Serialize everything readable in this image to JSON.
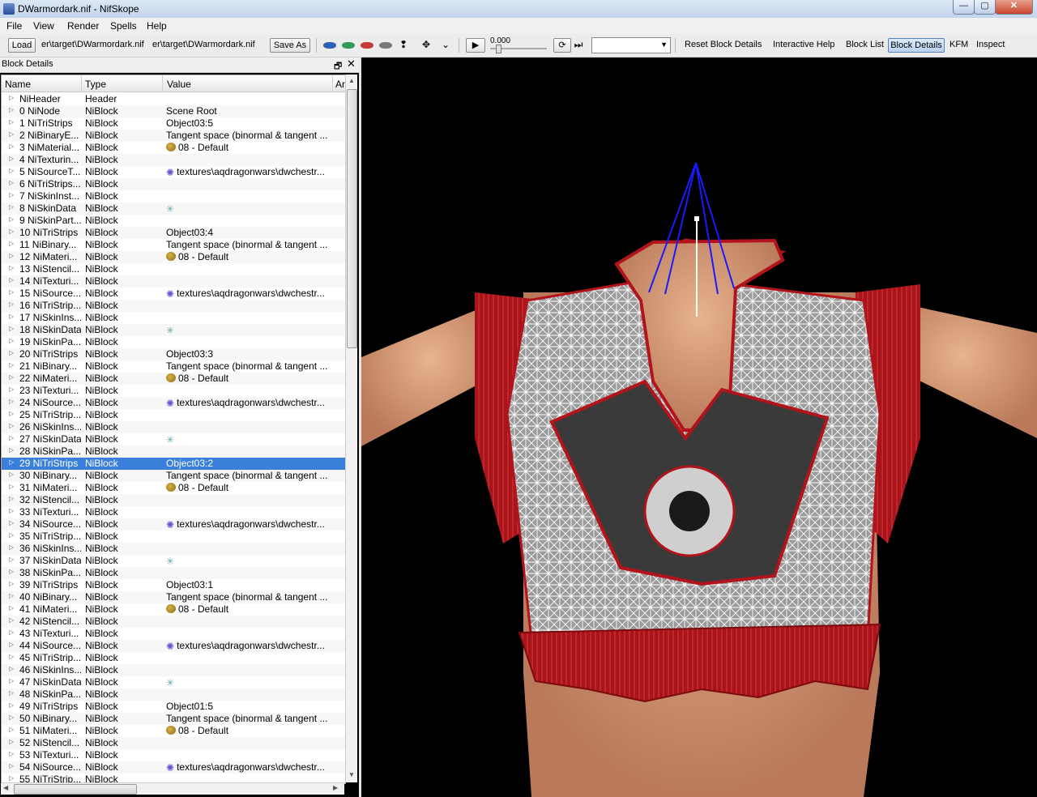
{
  "window": {
    "title": "DWarmordark.nif - NifSkope",
    "minimize": "—",
    "maximize": "▢",
    "close": "✕"
  },
  "menu": [
    "File",
    "View",
    "Render",
    "Spells",
    "Help"
  ],
  "toolbar": {
    "load_label": "Load",
    "load_path": "er\\target\\DWarmordark.nif",
    "save_path": "er\\target\\DWarmordark.nif",
    "save_as_label": "Save As",
    "time_value": "0.000",
    "reset_block_details": "Reset Block Details",
    "interactive_help": "Interactive Help",
    "block_list": "Block List",
    "block_details": "Block Details",
    "kfm": "KFM",
    "inspect": "Inspect"
  },
  "dock": {
    "title": "Block Details",
    "float": "🗗",
    "close": "✕"
  },
  "columns": {
    "name": "Name",
    "type": "Type",
    "value": "Value",
    "extra": "Ar"
  },
  "rows": [
    {
      "name": "NiHeader",
      "type": "Header",
      "value": "",
      "icon": ""
    },
    {
      "name": "0 NiNode",
      "type": "NiBlock",
      "value": "Scene Root",
      "icon": ""
    },
    {
      "name": "1 NiTriStrips",
      "type": "NiBlock",
      "value": "Object03:5",
      "icon": ""
    },
    {
      "name": "2 NiBinaryE...",
      "type": "NiBlock",
      "value": "Tangent space (binormal & tangent ...",
      "icon": ""
    },
    {
      "name": "3 NiMaterial...",
      "type": "NiBlock",
      "value": "08 - Default",
      "icon": "palette"
    },
    {
      "name": "4 NiTexturin...",
      "type": "NiBlock",
      "value": "",
      "icon": ""
    },
    {
      "name": "5 NiSourceT...",
      "type": "NiBlock",
      "value": "textures\\aqdragonwars\\dwchestr...",
      "icon": "texture"
    },
    {
      "name": "6 NiTriStrips...",
      "type": "NiBlock",
      "value": "",
      "icon": ""
    },
    {
      "name": "7 NiSkinInst...",
      "type": "NiBlock",
      "value": "",
      "icon": ""
    },
    {
      "name": "8 NiSkinData",
      "type": "NiBlock",
      "value": "",
      "icon": "skin"
    },
    {
      "name": "9 NiSkinPart...",
      "type": "NiBlock",
      "value": "",
      "icon": ""
    },
    {
      "name": "10 NiTriStrips",
      "type": "NiBlock",
      "value": "Object03:4",
      "icon": ""
    },
    {
      "name": "11 NiBinary...",
      "type": "NiBlock",
      "value": "Tangent space (binormal & tangent ...",
      "icon": ""
    },
    {
      "name": "12 NiMateri...",
      "type": "NiBlock",
      "value": "08 - Default",
      "icon": "palette"
    },
    {
      "name": "13 NiStencil...",
      "type": "NiBlock",
      "value": "",
      "icon": ""
    },
    {
      "name": "14 NiTexturi...",
      "type": "NiBlock",
      "value": "",
      "icon": ""
    },
    {
      "name": "15 NiSource...",
      "type": "NiBlock",
      "value": "textures\\aqdragonwars\\dwchestr...",
      "icon": "texture"
    },
    {
      "name": "16 NiTriStrip...",
      "type": "NiBlock",
      "value": "",
      "icon": ""
    },
    {
      "name": "17 NiSkinIns...",
      "type": "NiBlock",
      "value": "",
      "icon": ""
    },
    {
      "name": "18 NiSkinData",
      "type": "NiBlock",
      "value": "",
      "icon": "skin"
    },
    {
      "name": "19 NiSkinPa...",
      "type": "NiBlock",
      "value": "",
      "icon": ""
    },
    {
      "name": "20 NiTriStrips",
      "type": "NiBlock",
      "value": "Object03:3",
      "icon": ""
    },
    {
      "name": "21 NiBinary...",
      "type": "NiBlock",
      "value": "Tangent space (binormal & tangent ...",
      "icon": ""
    },
    {
      "name": "22 NiMateri...",
      "type": "NiBlock",
      "value": "08 - Default",
      "icon": "palette"
    },
    {
      "name": "23 NiTexturi...",
      "type": "NiBlock",
      "value": "",
      "icon": ""
    },
    {
      "name": "24 NiSource...",
      "type": "NiBlock",
      "value": "textures\\aqdragonwars\\dwchestr...",
      "icon": "texture"
    },
    {
      "name": "25 NiTriStrip...",
      "type": "NiBlock",
      "value": "",
      "icon": ""
    },
    {
      "name": "26 NiSkinIns...",
      "type": "NiBlock",
      "value": "",
      "icon": ""
    },
    {
      "name": "27 NiSkinData",
      "type": "NiBlock",
      "value": "",
      "icon": "skin"
    },
    {
      "name": "28 NiSkinPa...",
      "type": "NiBlock",
      "value": "",
      "icon": ""
    },
    {
      "name": "29 NiTriStrips",
      "type": "NiBlock",
      "value": "Object03:2",
      "icon": "",
      "selected": true
    },
    {
      "name": "30 NiBinary...",
      "type": "NiBlock",
      "value": "Tangent space (binormal & tangent ...",
      "icon": ""
    },
    {
      "name": "31 NiMateri...",
      "type": "NiBlock",
      "value": "08 - Default",
      "icon": "palette"
    },
    {
      "name": "32 NiStencil...",
      "type": "NiBlock",
      "value": "",
      "icon": ""
    },
    {
      "name": "33 NiTexturi...",
      "type": "NiBlock",
      "value": "",
      "icon": ""
    },
    {
      "name": "34 NiSource...",
      "type": "NiBlock",
      "value": "textures\\aqdragonwars\\dwchestr...",
      "icon": "texture"
    },
    {
      "name": "35 NiTriStrip...",
      "type": "NiBlock",
      "value": "",
      "icon": ""
    },
    {
      "name": "36 NiSkinIns...",
      "type": "NiBlock",
      "value": "",
      "icon": ""
    },
    {
      "name": "37 NiSkinData",
      "type": "NiBlock",
      "value": "",
      "icon": "skin"
    },
    {
      "name": "38 NiSkinPa...",
      "type": "NiBlock",
      "value": "",
      "icon": ""
    },
    {
      "name": "39 NiTriStrips",
      "type": "NiBlock",
      "value": "Object03:1",
      "icon": ""
    },
    {
      "name": "40 NiBinary...",
      "type": "NiBlock",
      "value": "Tangent space (binormal & tangent ...",
      "icon": ""
    },
    {
      "name": "41 NiMateri...",
      "type": "NiBlock",
      "value": "08 - Default",
      "icon": "palette"
    },
    {
      "name": "42 NiStencil...",
      "type": "NiBlock",
      "value": "",
      "icon": ""
    },
    {
      "name": "43 NiTexturi...",
      "type": "NiBlock",
      "value": "",
      "icon": ""
    },
    {
      "name": "44 NiSource...",
      "type": "NiBlock",
      "value": "textures\\aqdragonwars\\dwchestr...",
      "icon": "texture"
    },
    {
      "name": "45 NiTriStrip...",
      "type": "NiBlock",
      "value": "",
      "icon": ""
    },
    {
      "name": "46 NiSkinIns...",
      "type": "NiBlock",
      "value": "",
      "icon": ""
    },
    {
      "name": "47 NiSkinData",
      "type": "NiBlock",
      "value": "",
      "icon": "skin"
    },
    {
      "name": "48 NiSkinPa...",
      "type": "NiBlock",
      "value": "",
      "icon": ""
    },
    {
      "name": "49 NiTriStrips",
      "type": "NiBlock",
      "value": "Object01:5",
      "icon": ""
    },
    {
      "name": "50 NiBinary...",
      "type": "NiBlock",
      "value": "Tangent space (binormal & tangent ...",
      "icon": ""
    },
    {
      "name": "51 NiMateri...",
      "type": "NiBlock",
      "value": "08 - Default",
      "icon": "palette"
    },
    {
      "name": "52 NiStencil...",
      "type": "NiBlock",
      "value": "",
      "icon": ""
    },
    {
      "name": "53 NiTexturi...",
      "type": "NiBlock",
      "value": "",
      "icon": ""
    },
    {
      "name": "54 NiSource...",
      "type": "NiBlock",
      "value": "textures\\aqdragonwars\\dwchestr...",
      "icon": "texture"
    },
    {
      "name": "55 NiTriStrip...",
      "type": "NiBlock",
      "value": "",
      "icon": ""
    }
  ],
  "colors": {
    "selection": "#3a7fd9",
    "garment_red": "#b3141b",
    "skin": "#d9a07a",
    "bone_lines": "#1a1aff"
  },
  "icons": {
    "palette": "palette-icon",
    "texture": "texture-icon",
    "skin": "skin-data-icon"
  }
}
